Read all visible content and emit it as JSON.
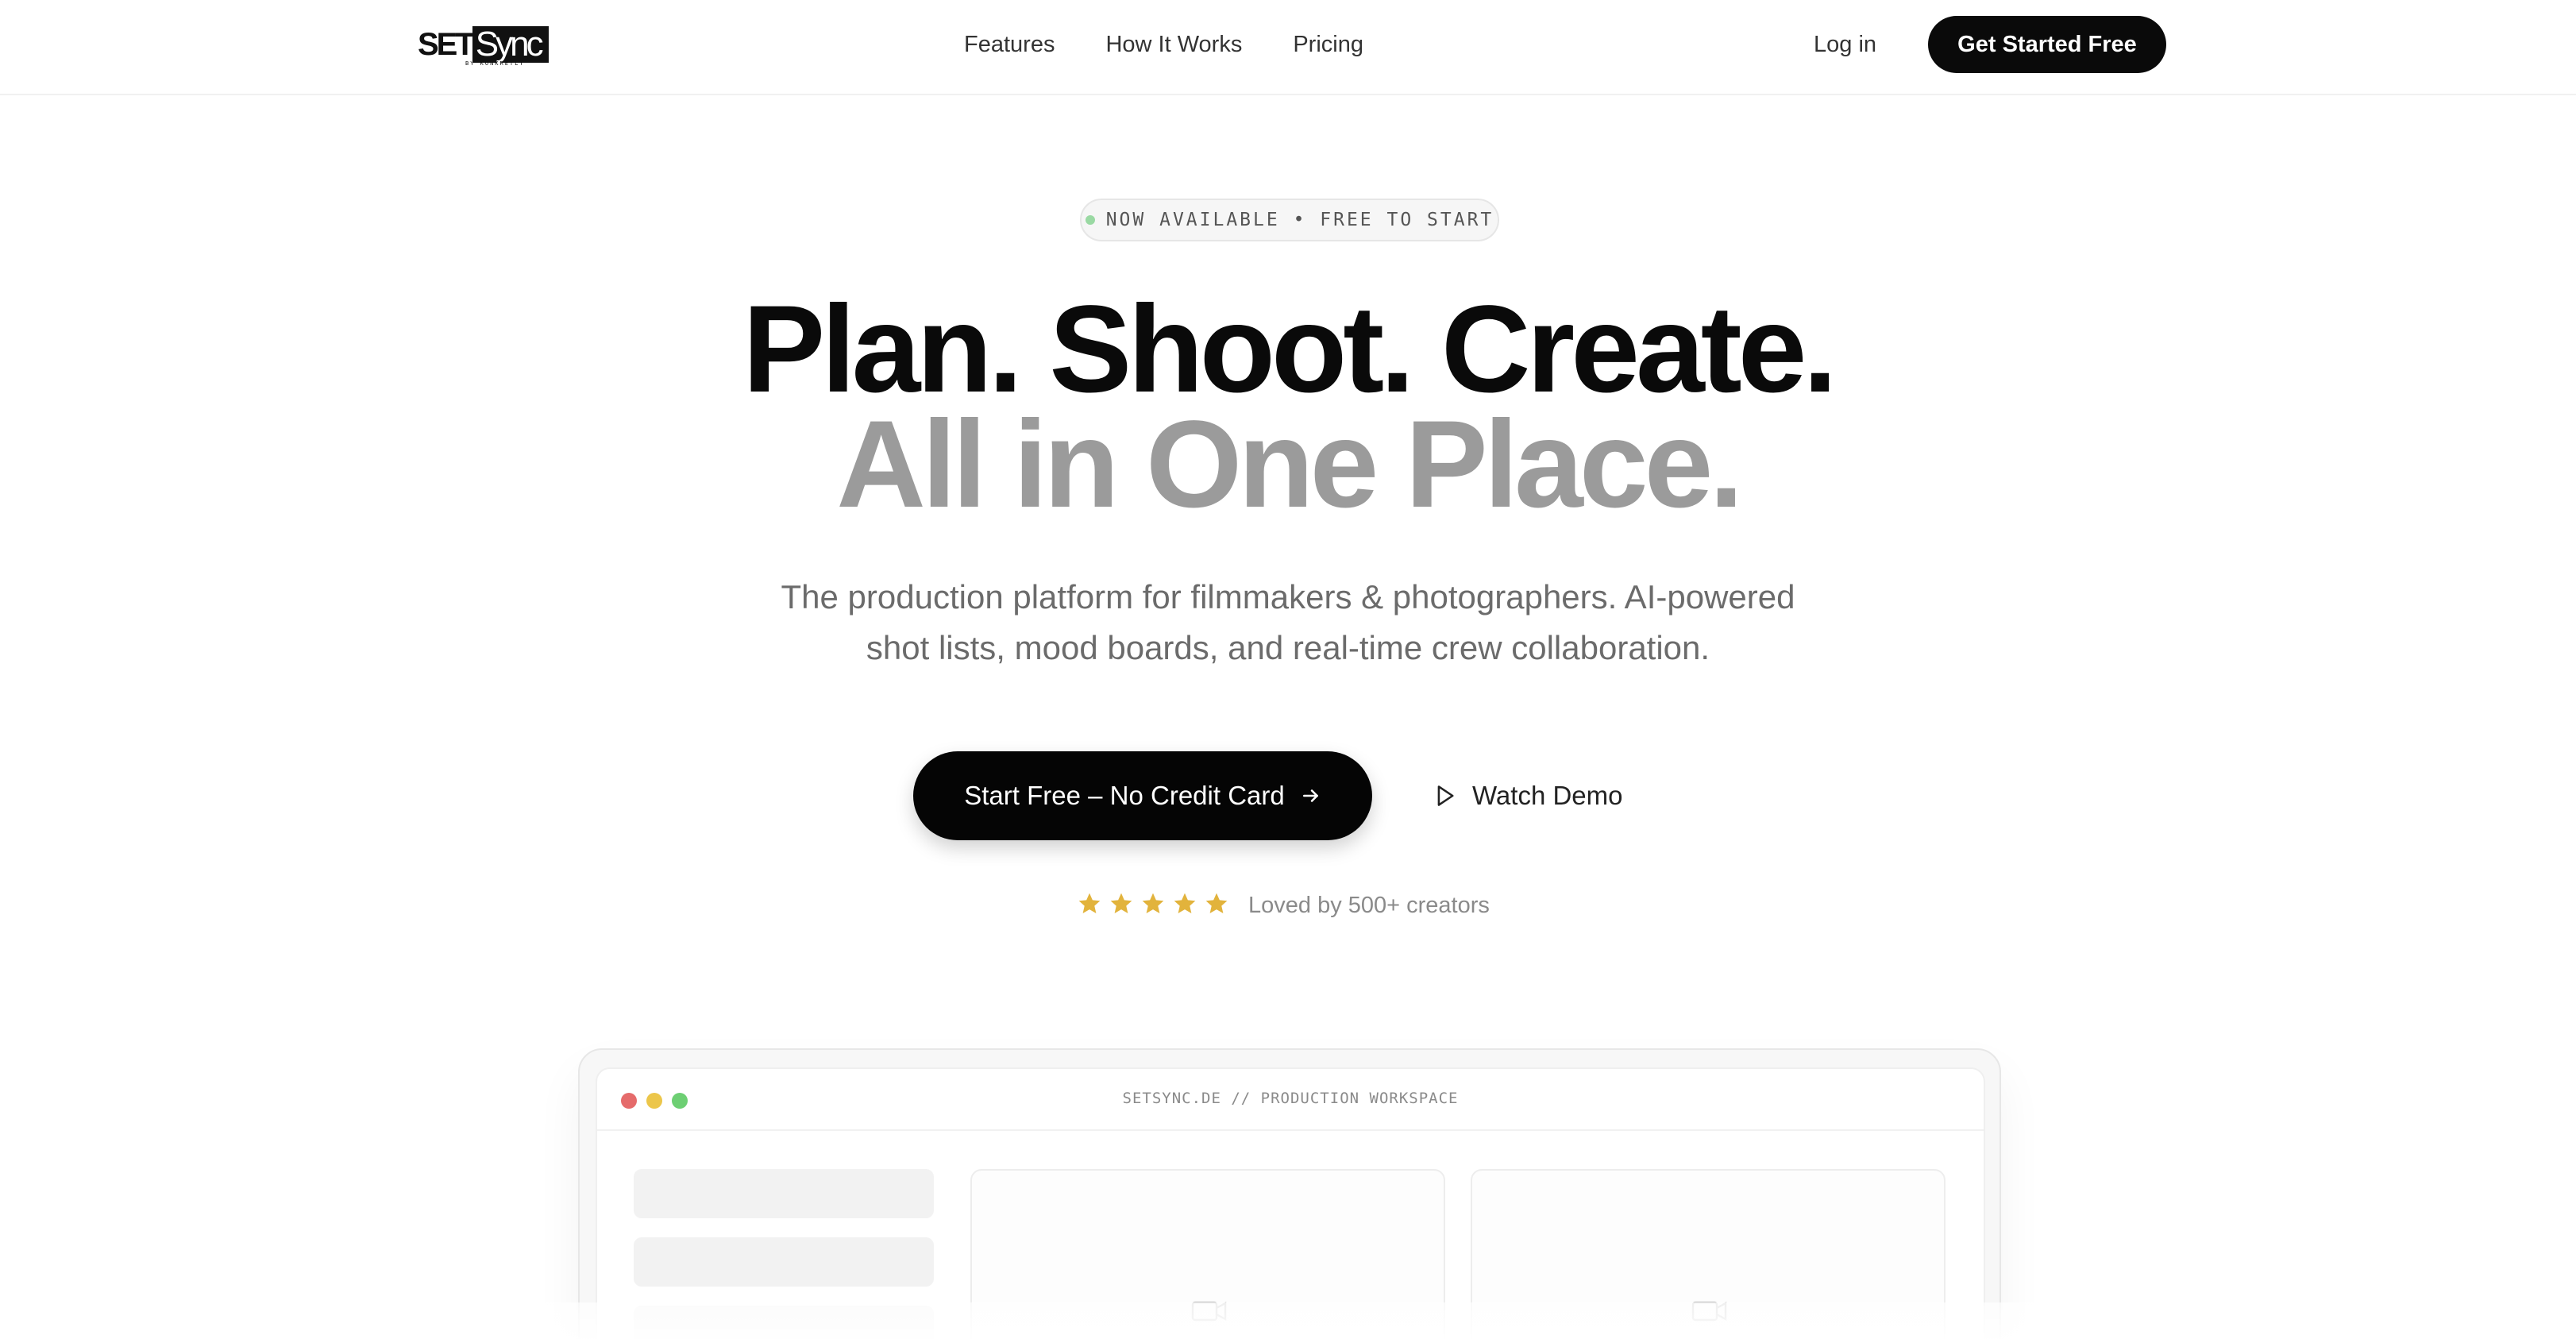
{
  "brand": {
    "logo_set": "SET",
    "logo_sync": "Sync",
    "logo_tagline": "BY KONKRETLY"
  },
  "nav": {
    "links": [
      "Features",
      "How It Works",
      "Pricing"
    ],
    "login": "Log in",
    "cta": "Get Started Free"
  },
  "hero": {
    "badge": "NOW AVAILABLE • FREE TO START",
    "headline_1": "Plan. Shoot. Create.",
    "headline_2": "All in One Place.",
    "subtitle_1": "The production platform for filmmakers & photographers. AI-powered",
    "subtitle_2": "shot lists, mood boards, and real-time crew collaboration.",
    "primary_cta": "Start Free – No Credit Card",
    "secondary_cta": "Watch Demo",
    "rating_stars": 5,
    "social_proof": "Loved by 500+ creators"
  },
  "mockup": {
    "window_title": "SETSYNC.DE // PRODUCTION WORKSPACE"
  },
  "colors": {
    "accent": "#0a0a0a",
    "headline_muted": "#9b9b9b",
    "badge_dot": "#9ad9a3",
    "star": "#e2b33c",
    "traffic_red": "#e56b6b",
    "traffic_yellow": "#ecc64a",
    "traffic_green": "#6dcf73"
  },
  "icons": {
    "cta_arrow": "arrow-right-icon",
    "demo": "play-icon",
    "rating": "star-icon",
    "panel": "image-icon"
  }
}
